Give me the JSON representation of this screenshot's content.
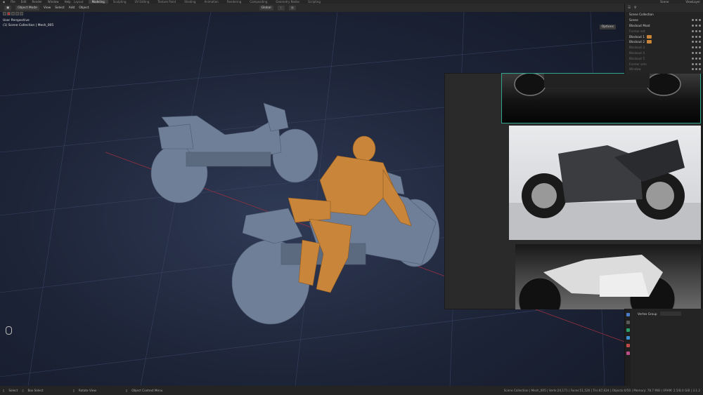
{
  "menu": [
    "File",
    "Edit",
    "Render",
    "Window",
    "Help"
  ],
  "workspaces": [
    "Layout",
    "Modeling",
    "Sculpting",
    "UV Editing",
    "Texture Paint",
    "Shading",
    "Animation",
    "Rendering",
    "Compositing",
    "Geometry Nodes",
    "Scripting"
  ],
  "active_workspace": "Modeling",
  "topright": {
    "scene": "Scene",
    "view_layer": "ViewLayer"
  },
  "toolbar": {
    "mode": "Object Mode",
    "view": "View",
    "select": "Select",
    "add": "Add",
    "object": "Object",
    "orientation": "Global",
    "options": "Options"
  },
  "viewport": {
    "line1": "User Perspective",
    "line2": "(1) Scene Collection | Mesh_005"
  },
  "outliner": {
    "rows": [
      {
        "label": "Scene Collection",
        "dim": false
      },
      {
        "label": "Scene",
        "dim": false
      },
      {
        "label": "Blockout Moat",
        "dim": false
      },
      {
        "label": "Former set",
        "dim": true
      },
      {
        "label": "Blockout 1",
        "dim": false
      },
      {
        "label": "Blockout 2",
        "dim": false
      },
      {
        "label": "Blockout 3",
        "dim": true
      },
      {
        "label": "Blockout 4",
        "dim": true
      },
      {
        "label": "Blockout 5",
        "dim": true
      },
      {
        "label": "Former sets",
        "dim": true
      },
      {
        "label": "Window",
        "dim": true
      }
    ]
  },
  "props": {
    "vertex_group": "Vertex Group"
  },
  "status": {
    "select": "Select",
    "box_select": "Box Select",
    "rotate": "Rotate View",
    "context": "Object Context Menu",
    "stats": "Scene Collection | Mesh_005 | Verts:24,171 | Faces:51,526 | Tris:87,624 | Objects:0/50 | Memory: 78.7 MiB | VRAM: 2.5/8.0 GiB | 3.1.2"
  },
  "colors": {
    "accent": "#e8a23a",
    "viewport": "#1d2438",
    "selection": "#2fa58a",
    "figure": "#c9863a",
    "mesh": "#6f7f97"
  }
}
